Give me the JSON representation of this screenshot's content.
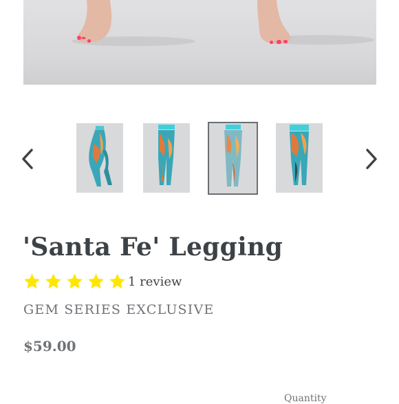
{
  "product": {
    "title": "'Santa Fe' Legging",
    "rating": 5,
    "review_count_label": "1 review",
    "vendor_label": "GEM SERIES EXCLUSIVE",
    "price": "$59.00"
  },
  "gallery": {
    "active_thumbnail": 3,
    "thumbnail_count": 4,
    "prev_icon": "chevron-left-icon",
    "next_icon": "chevron-right-icon"
  },
  "form": {
    "quantity_label": "Quantity"
  },
  "colors": {
    "star": "#ffe600",
    "text": "#3d4246",
    "muted": "#6f7276"
  }
}
